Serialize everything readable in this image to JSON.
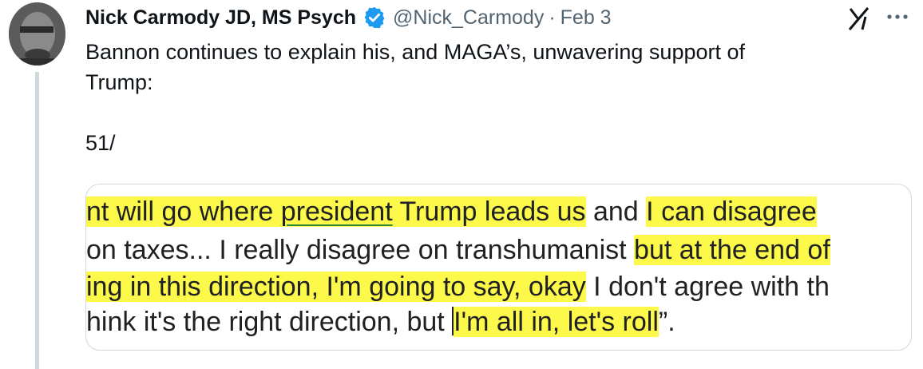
{
  "tweet": {
    "author_name": "Nick Carmody JD, MS Psych",
    "handle": "@Nick_Carmody",
    "separator": "·",
    "date": "Feb 3",
    "text_line1": "Bannon continues to explain his, and MAGA’s, unwavering support of",
    "text_line2": "Trump:",
    "text_line3": "",
    "text_line4": "51/"
  },
  "media": {
    "line1": {
      "a": "nt will go where ",
      "b": "president",
      "c": " Trump leads us",
      "d": " and ",
      "e": "I can disagree"
    },
    "line2": {
      "a": "on taxes... I really disagree on transhumanist ",
      "b": "but at the end of"
    },
    "line3": {
      "a": "ing in this direction, I'm going to say, okay",
      "b": " I don't agree with th"
    },
    "line4": {
      "a": "hink it's the right direction, but ",
      "b": "I'm all in, let's roll",
      "c": "”."
    }
  },
  "icons": {
    "verified": "verified-badge-icon",
    "grok": "grok-icon",
    "more": "more-options-icon"
  },
  "colors": {
    "verified": "#1d9bf0",
    "highlight": "#fcf94a",
    "secondary_text": "#536471"
  }
}
